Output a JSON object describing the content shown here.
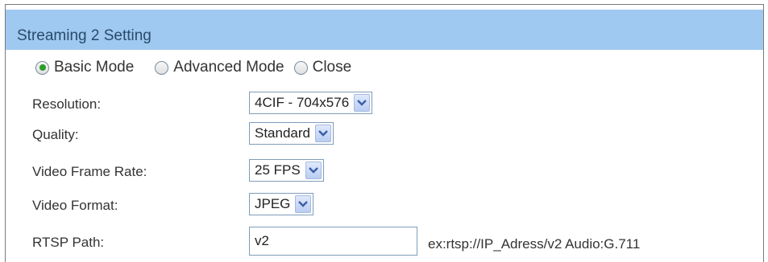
{
  "section": {
    "title": "Streaming 2 Setting"
  },
  "modes": [
    {
      "label": "Basic Mode",
      "selected": true
    },
    {
      "label": "Advanced Mode",
      "selected": false
    },
    {
      "label": "Close",
      "selected": false
    }
  ],
  "fields": {
    "resolution": {
      "label": "Resolution:",
      "value": "4CIF - 704x576"
    },
    "quality": {
      "label": "Quality:",
      "value": "Standard"
    },
    "frame_rate": {
      "label": "Video Frame Rate:",
      "value": "25 FPS"
    },
    "format": {
      "label": "Video Format:",
      "value": "JPEG"
    },
    "rtsp": {
      "label": "RTSP Path:",
      "value": "v2",
      "hint": "ex:rtsp://IP_Adress/v2   Audio:G.711"
    }
  },
  "colors": {
    "header_bg": "#9fc9f1",
    "selected_radio": "#2a9d2a"
  },
  "icons": {
    "dropdown": "chevron-down-icon"
  }
}
